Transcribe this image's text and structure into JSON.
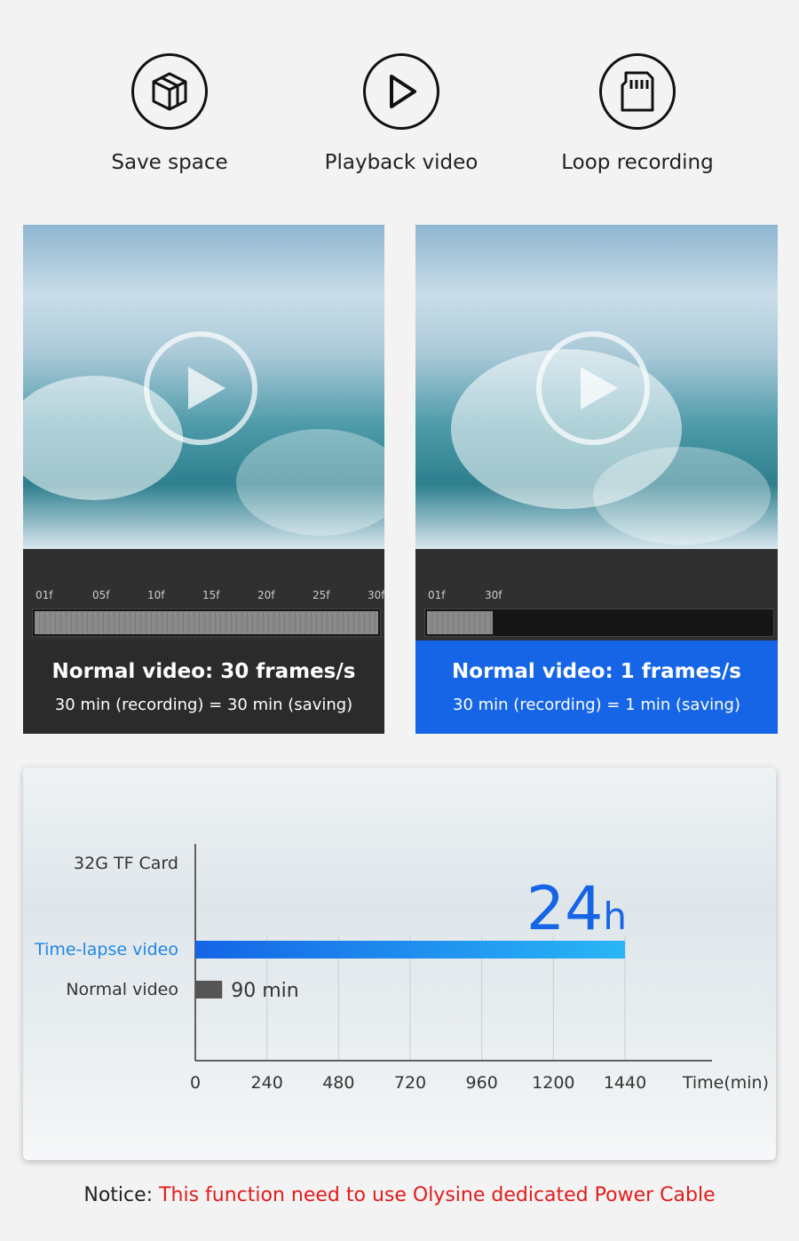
{
  "features": [
    {
      "icon": "cube-icon",
      "label": "Save space"
    },
    {
      "icon": "play-icon",
      "label": "Playback video"
    },
    {
      "icon": "sd-card-icon",
      "label": "Loop recording"
    }
  ],
  "panels": [
    {
      "ticks": [
        "01f",
        "05f",
        "10f",
        "15f",
        "20f",
        "25f",
        "30f"
      ],
      "title": "Normal video: 30 frames/s",
      "subtitle": "30 min (recording) = 30 min (saving)",
      "color": "#2b2b2b"
    },
    {
      "ticks": [
        "01f",
        "30f"
      ],
      "title": "Normal video: 1 frames/s",
      "subtitle": "30 min (recording) = 1 min (saving)",
      "color": "#1565e6"
    }
  ],
  "chart_data": {
    "type": "bar",
    "orientation": "horizontal",
    "title": "32G TF Card",
    "categories": [
      "Time-lapse video",
      "Normal video"
    ],
    "values": [
      1440,
      90
    ],
    "value_labels": [
      "24h",
      "90 min"
    ],
    "xlabel": "Time(min)",
    "xticks": [
      "0",
      "240",
      "480",
      "720",
      "960",
      "1200",
      "1440"
    ],
    "xlim": [
      0,
      1740
    ],
    "colors": {
      "timelapse": "#1e88e5",
      "normal": "#555555",
      "highlight": "#1565e6"
    }
  },
  "notice": {
    "prefix": "Notice: ",
    "text": "This function need to use Olysine dedicated Power Cable",
    "color": "#e21b1b"
  }
}
